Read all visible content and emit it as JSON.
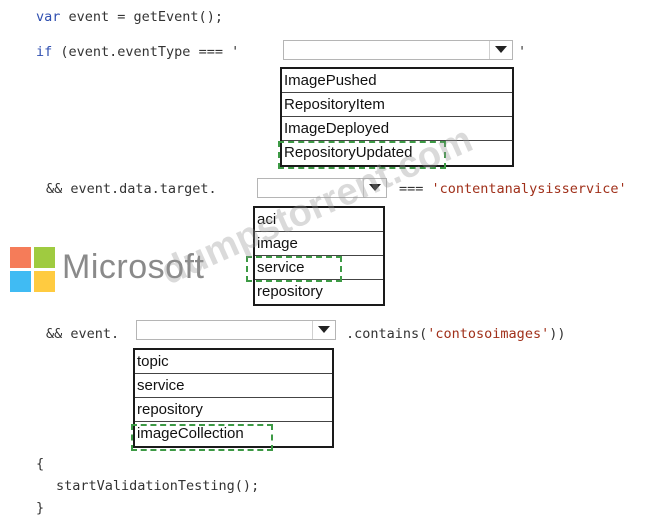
{
  "code": {
    "line1_var": "var",
    "line1_rest": " event = getEvent();",
    "line2_if": "if",
    "line2_rest": " (event.eventType === '",
    "line2_end": "'",
    "line3_text": "&& event.data.target.",
    "line3_op": "===",
    "line3_str": "'contentanalysisservice'",
    "line4_text": "&& event.",
    "line4_rest": ".contains(",
    "line4_str": "'contosoimages'",
    "line4_end": "))",
    "open_brace": "{",
    "call": "startValidationTesting();",
    "close_brace": "}"
  },
  "dropdown1": {
    "options": [
      "ImagePushed",
      "RepositoryItem",
      "ImageDeployed",
      "RepositoryUpdated"
    ],
    "selected": "RepositoryUpdated"
  },
  "dropdown2": {
    "options": [
      "aci",
      "image",
      "service",
      "repository"
    ],
    "selected": "service"
  },
  "dropdown3": {
    "options": [
      "topic",
      "service",
      "repository",
      "imageCollection"
    ],
    "selected": "imageCollection"
  },
  "watermark": {
    "brand": "Microsoft",
    "site": "dumpstorrent.com",
    "logo_colors": [
      "#f25022",
      "#7fba00",
      "#00a4ef",
      "#ffb900"
    ]
  }
}
